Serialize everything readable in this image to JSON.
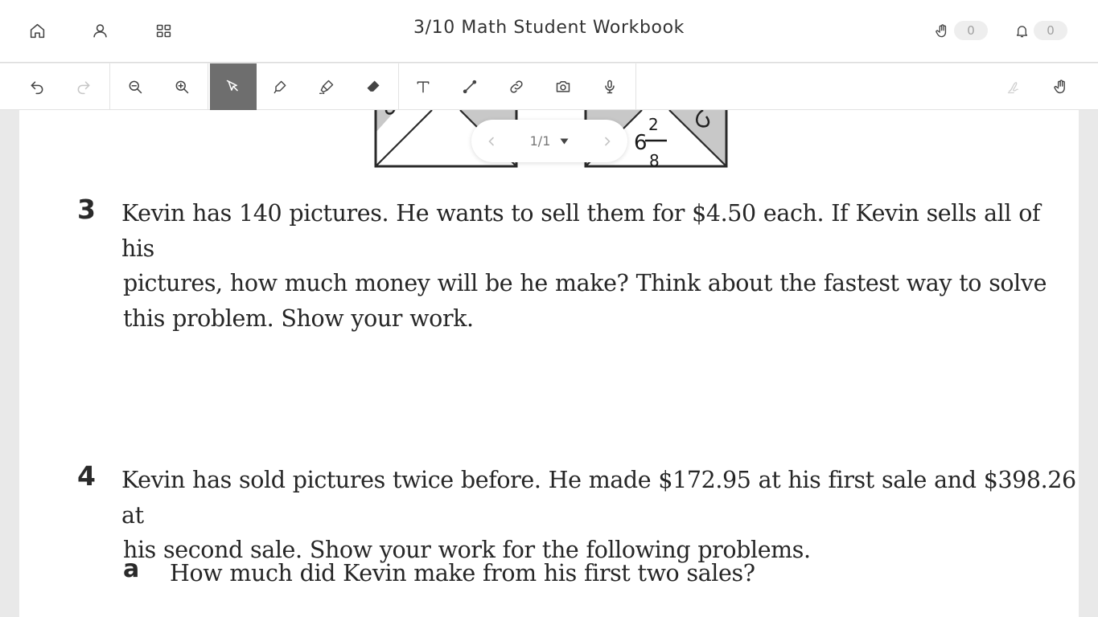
{
  "header": {
    "title": "3/10 Math Student Workbook",
    "hand_raise_count": "0",
    "notification_count": "0"
  },
  "toolbar": {
    "tools": [
      "undo-icon",
      "redo-icon",
      "zoom-out-icon",
      "zoom-in-icon",
      "select-cursor-icon",
      "pen-icon",
      "highlighter-icon",
      "eraser-icon",
      "text-icon",
      "line-icon",
      "link-icon",
      "camera-icon",
      "microphone-icon",
      "signature-icon",
      "hand-pan-icon"
    ],
    "active_tool": "select-cursor-icon"
  },
  "pager": {
    "page_indicator": "1/1"
  },
  "worksheet": {
    "figure_handwritten_whole": "6",
    "figure_handwritten_numerator": "2",
    "figure_handwritten_denominator": "8",
    "question3": {
      "number": "3",
      "lines": [
        "Kevin has 140 pictures. He wants to sell them for $4.50 each. If Kevin sells all of his",
        "pictures, how much money will be he make? Think about the fastest way to solve",
        "this problem. Show your work."
      ]
    },
    "question4": {
      "number": "4",
      "lines": [
        "Kevin has sold pictures twice before. He made $172.95 at his first sale and $398.26 at",
        "his second sale. Show your work for the following problems."
      ],
      "part_a": {
        "letter": "a",
        "text": "How much did Kevin make from his first two sales?"
      }
    }
  },
  "colors": {
    "active_tool_bg": "#6e6e6e",
    "icon": "#444444",
    "disabled_icon": "#c6c6c6",
    "pill_bg": "#eeeeee",
    "page_bg": "#e9e9e9"
  }
}
